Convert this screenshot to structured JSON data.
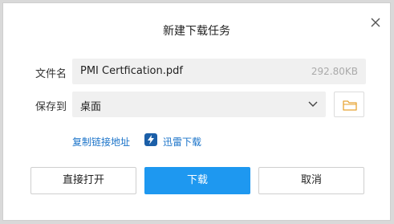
{
  "dialog": {
    "title": "新建下载任务",
    "close_icon": "close-icon"
  },
  "file": {
    "label": "文件名",
    "name": "PMI Certfication.pdf",
    "size": "292.80KB"
  },
  "save": {
    "label": "保存到",
    "location": "桌面",
    "dropdown_icon": "chevron-down-icon",
    "folder_icon": "folder-icon"
  },
  "links": {
    "copy_link": "复制链接地址",
    "thunder": "迅雷下载",
    "thunder_icon": "thunder-icon"
  },
  "buttons": {
    "open": "直接打开",
    "download": "下载",
    "cancel": "取消"
  },
  "colors": {
    "accent": "#1e98f0",
    "link": "#1a73c9",
    "folder": "#f2b84b"
  }
}
